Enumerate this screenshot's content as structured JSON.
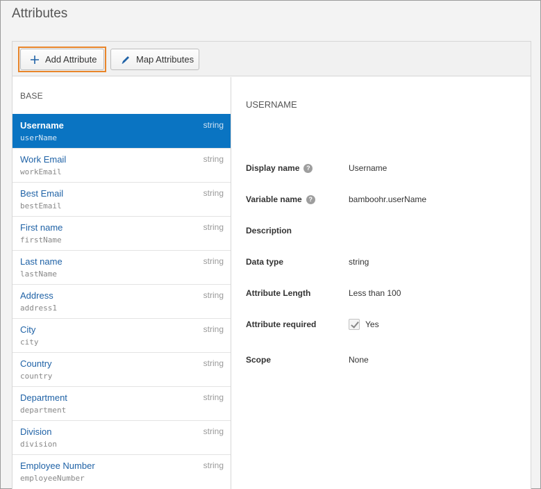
{
  "page": {
    "title": "Attributes"
  },
  "toolbar": {
    "add_label": "Add Attribute",
    "map_label": "Map Attributes"
  },
  "list": {
    "header": "BASE",
    "items": [
      {
        "label": "Username",
        "var": "userName",
        "type": "string"
      },
      {
        "label": "Work Email",
        "var": "workEmail",
        "type": "string"
      },
      {
        "label": "Best Email",
        "var": "bestEmail",
        "type": "string"
      },
      {
        "label": "First name",
        "var": "firstName",
        "type": "string"
      },
      {
        "label": "Last name",
        "var": "lastName",
        "type": "string"
      },
      {
        "label": "Address",
        "var": "address1",
        "type": "string"
      },
      {
        "label": "City",
        "var": "city",
        "type": "string"
      },
      {
        "label": "Country",
        "var": "country",
        "type": "string"
      },
      {
        "label": "Department",
        "var": "department",
        "type": "string"
      },
      {
        "label": "Division",
        "var": "division",
        "type": "string"
      },
      {
        "label": "Employee Number",
        "var": "employeeNumber",
        "type": "string"
      }
    ]
  },
  "detail": {
    "title": "USERNAME",
    "display_name_key": "Display name",
    "display_name_val": "Username",
    "variable_name_key": "Variable name",
    "variable_name_val": "bamboohr.userName",
    "description_key": "Description",
    "description_val": "",
    "data_type_key": "Data type",
    "data_type_val": "string",
    "length_key": "Attribute Length",
    "length_val": "Less than 100",
    "required_key": "Attribute required",
    "required_val": "Yes",
    "scope_key": "Scope",
    "scope_val": "None",
    "help_glyph": "?"
  },
  "colors": {
    "accent": "#0a74c2",
    "highlight_outline": "#e8852a",
    "link": "#1f62a6"
  }
}
